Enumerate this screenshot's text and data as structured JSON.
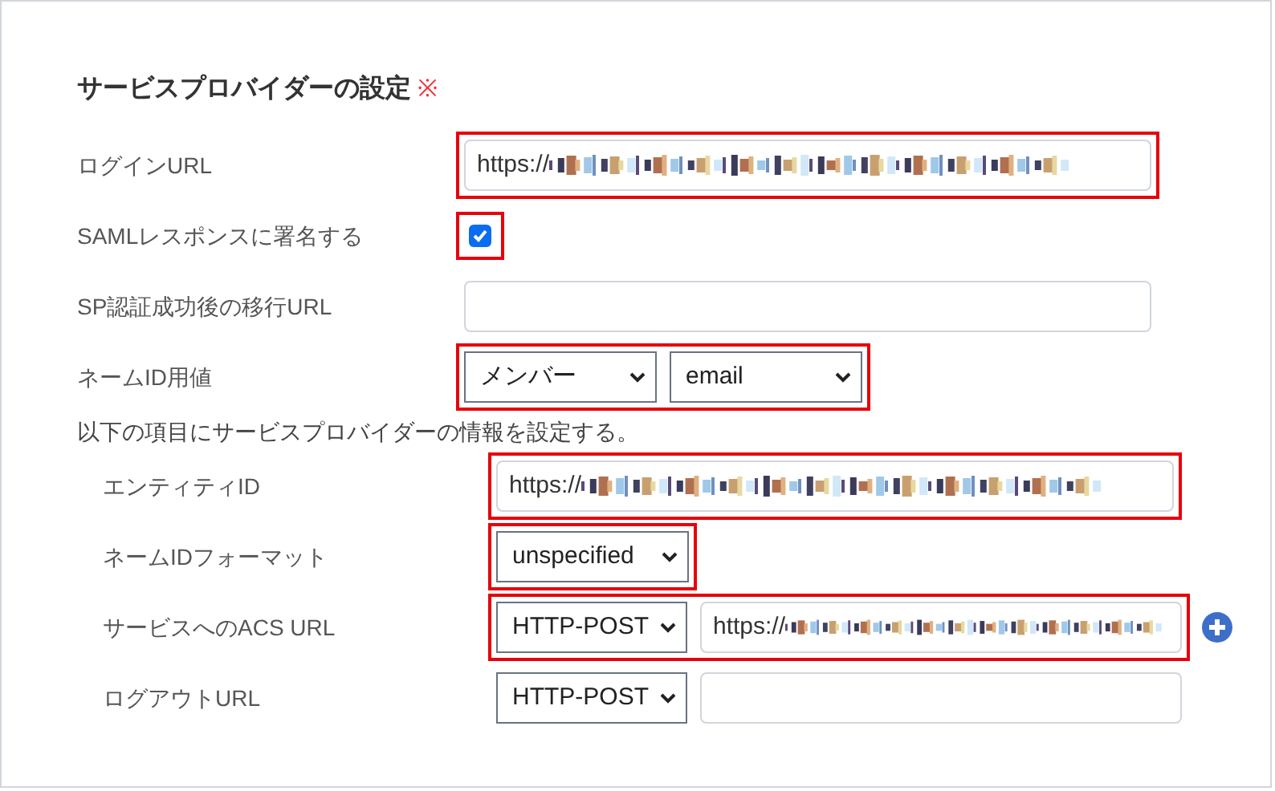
{
  "section": {
    "title": "サービスプロバイダーの設定",
    "required_mark": "※"
  },
  "fields": [
    {
      "kind": "text",
      "label": "ログインURL",
      "value": "https://",
      "redacted": true,
      "highlighted": true
    },
    {
      "kind": "checkbox",
      "label": "SAMLレスポンスに署名する",
      "checked": true,
      "highlighted": true
    },
    {
      "kind": "text",
      "label": "SP認証成功後の移行URL",
      "highlighted": false
    },
    {
      "kind": "selects",
      "label": "ネームID用値",
      "selects": [
        "メンバー",
        "email"
      ],
      "highlighted": true
    }
  ],
  "note": "以下の項目にサービスプロバイダーの情報を設定する。",
  "sub_fields": [
    {
      "kind": "text",
      "label": "エンティティID",
      "value": "https://",
      "redacted": true,
      "highlighted": true
    },
    {
      "kind": "selects",
      "label": "ネームIDフォーマット",
      "selects": [
        "unspecified"
      ],
      "highlighted": true
    },
    {
      "kind": "select_text",
      "label": "サービスへのACS URL",
      "selects": [
        "HTTP-POST"
      ],
      "value": "https://",
      "redacted": true,
      "highlighted": true,
      "add_button": true
    },
    {
      "kind": "select_text",
      "label": "ログアウトURL",
      "selects": [
        "HTTP-POST"
      ],
      "highlighted": false,
      "add_button": false
    }
  ]
}
